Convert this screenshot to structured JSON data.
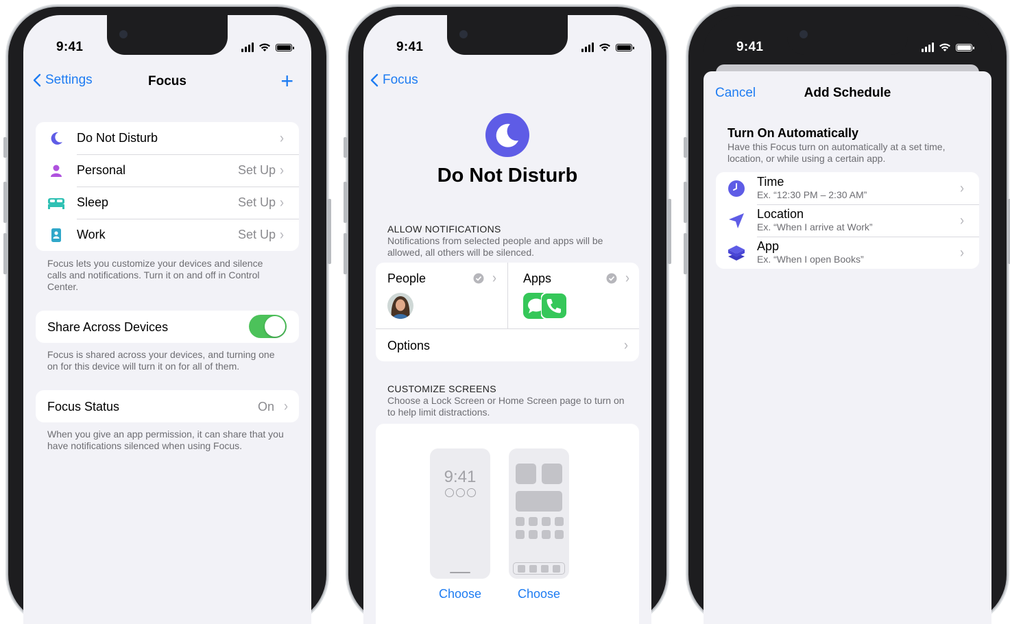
{
  "status": {
    "time": "9:41"
  },
  "screen1": {
    "nav": {
      "back_label": "Settings",
      "title": "Focus",
      "add_label": "+"
    },
    "focus_items": [
      {
        "label": "Do Not Disturb",
        "value": "",
        "icon": "moon-icon",
        "color": "#5e5ce6"
      },
      {
        "label": "Personal",
        "value": "Set Up",
        "icon": "person-icon",
        "color": "#af52de"
      },
      {
        "label": "Sleep",
        "value": "Set Up",
        "icon": "bed-icon",
        "color": "#30c1b4"
      },
      {
        "label": "Work",
        "value": "Set Up",
        "icon": "badge-icon",
        "color": "#30a7c9"
      }
    ],
    "focus_footer": "Focus lets you customize your devices and silence calls and notifications. Turn it on and off in Control Center.",
    "share": {
      "label": "Share Across Devices",
      "enabled": true
    },
    "share_footer": "Focus is shared across your devices, and turning one on for this device will turn it on for all of them.",
    "status_row": {
      "label": "Focus Status",
      "value": "On"
    },
    "status_footer": "When you give an app permission, it can share that you have notifications silenced when using Focus."
  },
  "screen2": {
    "nav": {
      "back_label": "Focus"
    },
    "title": "Do Not Disturb",
    "allow_header": "ALLOW NOTIFICATIONS",
    "allow_sub": "Notifications from selected people and apps will be allowed, all others will be silenced.",
    "people_label": "People",
    "apps_label": "Apps",
    "options_label": "Options",
    "customize_header": "CUSTOMIZE SCREENS",
    "customize_sub": "Choose a Lock Screen or Home Screen page to turn on to help limit distractions.",
    "lock_time": "9:41",
    "choose_label_1": "Choose",
    "choose_label_2": "Choose"
  },
  "screen3": {
    "nav": {
      "cancel_label": "Cancel",
      "title": "Add Schedule"
    },
    "section_title": "Turn On Automatically",
    "section_sub": "Have this Focus turn on automatically at a set time, location, or while using a certain app.",
    "options": [
      {
        "label": "Time",
        "example": "Ex. “12:30 PM – 2:30 AM”",
        "icon": "clock-icon"
      },
      {
        "label": "Location",
        "example": "Ex. “When I arrive at Work”",
        "icon": "location-arrow-icon"
      },
      {
        "label": "App",
        "example": "Ex. “When I open Books”",
        "icon": "layers-icon"
      }
    ]
  },
  "colors": {
    "accent": "#1e7cf2",
    "focus_purple": "#5e5ce6",
    "toggle_on": "#4cc25a"
  }
}
